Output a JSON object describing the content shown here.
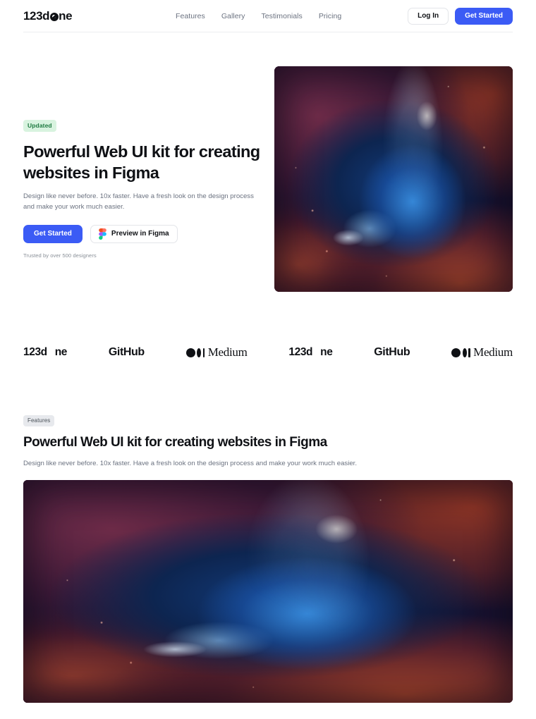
{
  "brand": {
    "prefix": "123d",
    "mark_icon": "slashed-o-icon",
    "suffix": "ne"
  },
  "nav": {
    "links": [
      {
        "label": "Features"
      },
      {
        "label": "Gallery"
      },
      {
        "label": "Testimonials"
      },
      {
        "label": "Pricing"
      }
    ],
    "login_label": "Log In",
    "get_started_label": "Get Started"
  },
  "hero": {
    "badge": "Updated",
    "title": "Powerful Web UI kit for creating websites in Figma",
    "subtitle": "Design like never before. 10x faster. Have a fresh look on the design process and make your work much easier.",
    "cta_primary": "Get Started",
    "cta_secondary": "Preview in Figma",
    "cta_secondary_icon": "figma-icon",
    "trusted": "Trusted by over 500 designers",
    "artwork_alt": "blue-nebula-image"
  },
  "logos": [
    {
      "type": "123done",
      "prefix": "123d",
      "suffix": "ne",
      "label": "123done"
    },
    {
      "type": "github",
      "label": "GitHub"
    },
    {
      "type": "medium",
      "label": "Medium"
    },
    {
      "type": "123done",
      "prefix": "123d",
      "suffix": "ne",
      "label": "123done"
    },
    {
      "type": "github",
      "label": "GitHub"
    },
    {
      "type": "medium",
      "label": "Medium"
    }
  ],
  "features": {
    "badge": "Features",
    "title": "Powerful Web UI kit for creating websites in Figma",
    "subtitle": "Design like never before. 10x faster. Have a fresh look on the design process and make your work much easier.",
    "artwork_alt": "blue-nebula-wide-image"
  },
  "colors": {
    "accent": "#3b5bf5",
    "text_primary": "#0f1115",
    "text_muted": "#6b7280",
    "badge_green_bg": "#d8f3df",
    "badge_green_fg": "#1f7a41",
    "badge_gray_bg": "#e7e9ed",
    "border": "#e3e5e9"
  }
}
